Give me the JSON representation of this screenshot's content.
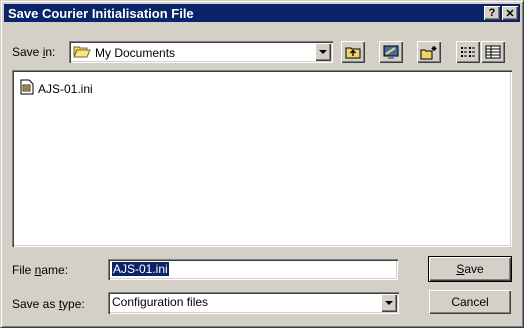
{
  "window": {
    "title": "Save Courier Initialisation File",
    "help_label": "?",
    "close_label": "✕"
  },
  "save_in": {
    "label_pre": "Save ",
    "label_acc": "i",
    "label_post": "n:",
    "value": "My Documents",
    "icon": "folder-icon"
  },
  "toolbar": {
    "up_icon": "up-one-level-icon",
    "desktop_icon": "desktop-icon",
    "new_folder_icon": "new-folder-icon",
    "list_icon": "list-view-icon",
    "details_icon": "details-view-icon"
  },
  "files": [
    {
      "name": "AJS-01.ini",
      "icon": "ini-file-icon"
    }
  ],
  "file_name": {
    "label_pre": "File ",
    "label_acc": "n",
    "label_post": "ame:",
    "value": "AJS-01.ini"
  },
  "save_type": {
    "label_pre": "Save as ",
    "label_acc": "t",
    "label_post": "ype:",
    "value": "Configuration files"
  },
  "buttons": {
    "save_acc": "S",
    "save_rest": "ave",
    "cancel": "Cancel"
  },
  "colors": {
    "title_bar": "#0a246a",
    "face": "#d4d0c8",
    "selection": "#0a246a"
  }
}
